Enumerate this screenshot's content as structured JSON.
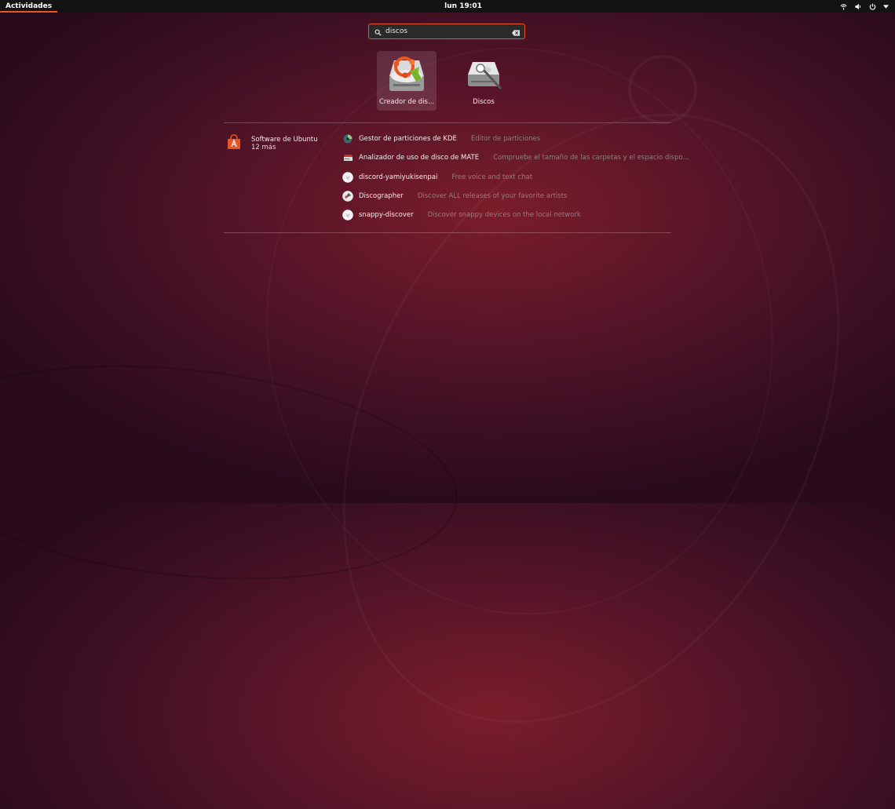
{
  "topbar": {
    "activities_label": "Actividades",
    "clock": "lun 19:01",
    "tray_icons": [
      "wifi-icon",
      "volume-icon",
      "power-icon",
      "chevron-down-icon"
    ]
  },
  "search": {
    "value": "discos",
    "icons": [
      "search-icon",
      "clear-icon"
    ]
  },
  "apps": [
    {
      "label": "Creador de dis...",
      "icon": "startup-disk-creator-icon",
      "selected": true
    },
    {
      "label": "Discos",
      "icon": "disks-icon",
      "selected": false
    }
  ],
  "provider": {
    "name": "Software de Ubuntu",
    "more": "12 más",
    "icon": "ubuntu-software-icon",
    "accent": "#e95420"
  },
  "results": [
    {
      "name": "Gestor de particiones de KDE",
      "description": "Editor de particiones",
      "icon": "partition-manager-icon"
    },
    {
      "name": "Analizador de uso de disco de MATE",
      "description": "Compruebe el tamaño de las carpetas y el espacio dispo...",
      "icon": "disk-usage-analyzer-icon"
    },
    {
      "name": "discord-yamiyukisenpai",
      "description": "Free voice and text chat",
      "icon": "discord-snap-icon"
    },
    {
      "name": "Discographer",
      "description": "Discover ALL releases of your favorite artists",
      "icon": "discographer-icon"
    },
    {
      "name": "snappy-discover",
      "description": "Discover snappy devices on the local network",
      "icon": "snappy-discover-icon"
    }
  ]
}
